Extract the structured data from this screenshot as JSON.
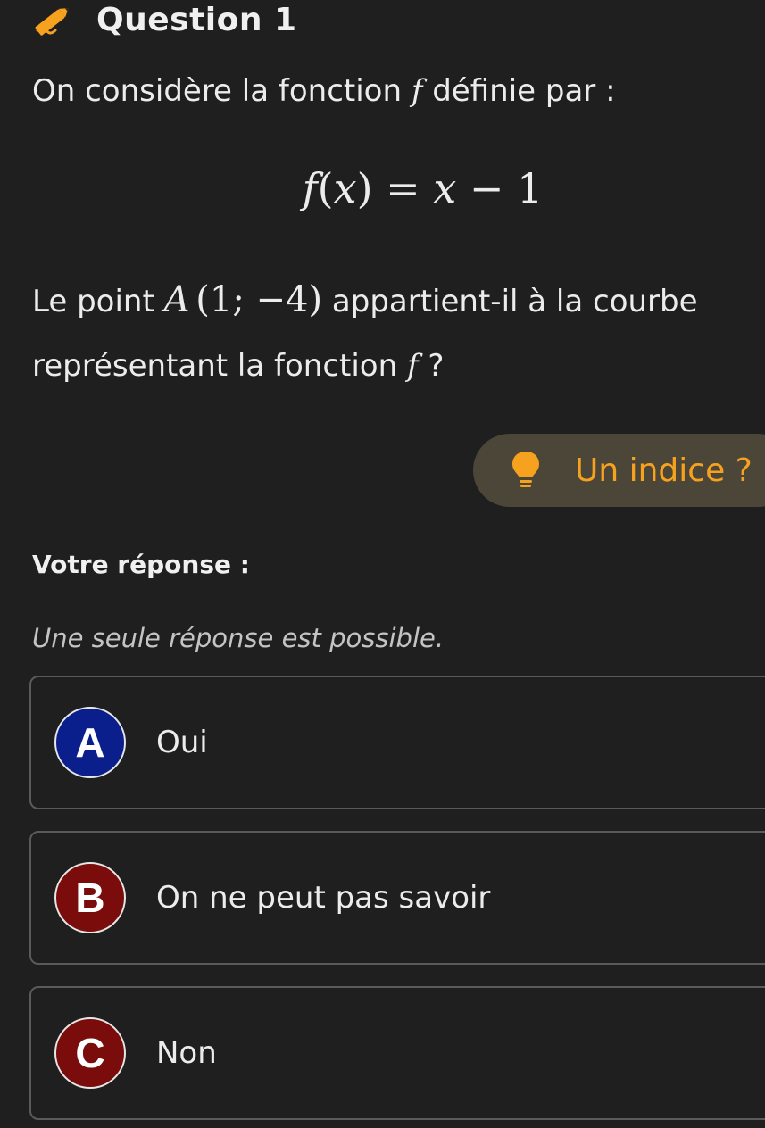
{
  "question": {
    "title": "Question 1",
    "intro_before": "On considère la fonction ",
    "intro_var": "f",
    "intro_after": " définie par :",
    "formula": {
      "lhs_fn": "f",
      "lhs_paren_open": "(",
      "lhs_var": "x",
      "lhs_paren_close": ")",
      "equals": "=",
      "rhs_var": "x",
      "minus": "−",
      "constant": "1"
    },
    "text_before": "Le point ",
    "point_name": "A",
    "point_coords": "(1; −4)",
    "text_after": " appartient-il à la courbe représentant la fonction ",
    "text_var": "f",
    "text_end": " ?"
  },
  "hint": {
    "label": "Un indice ?"
  },
  "answer": {
    "title": "Votre réponse :",
    "note": "Une seule réponse est possible.",
    "options": [
      {
        "letter": "A",
        "label": "Oui",
        "color": "#0b1f8c"
      },
      {
        "letter": "B",
        "label": "On ne peut pas savoir",
        "color": "#7a0c0c"
      },
      {
        "letter": "C",
        "label": "Non",
        "color": "#7a0c0c"
      }
    ]
  },
  "colors": {
    "background": "#1f1f1f",
    "accent": "#f6a21e",
    "hint_bg": "#4c4638"
  },
  "icons": {
    "header": "pencil-icon",
    "hint": "lightbulb-icon"
  }
}
